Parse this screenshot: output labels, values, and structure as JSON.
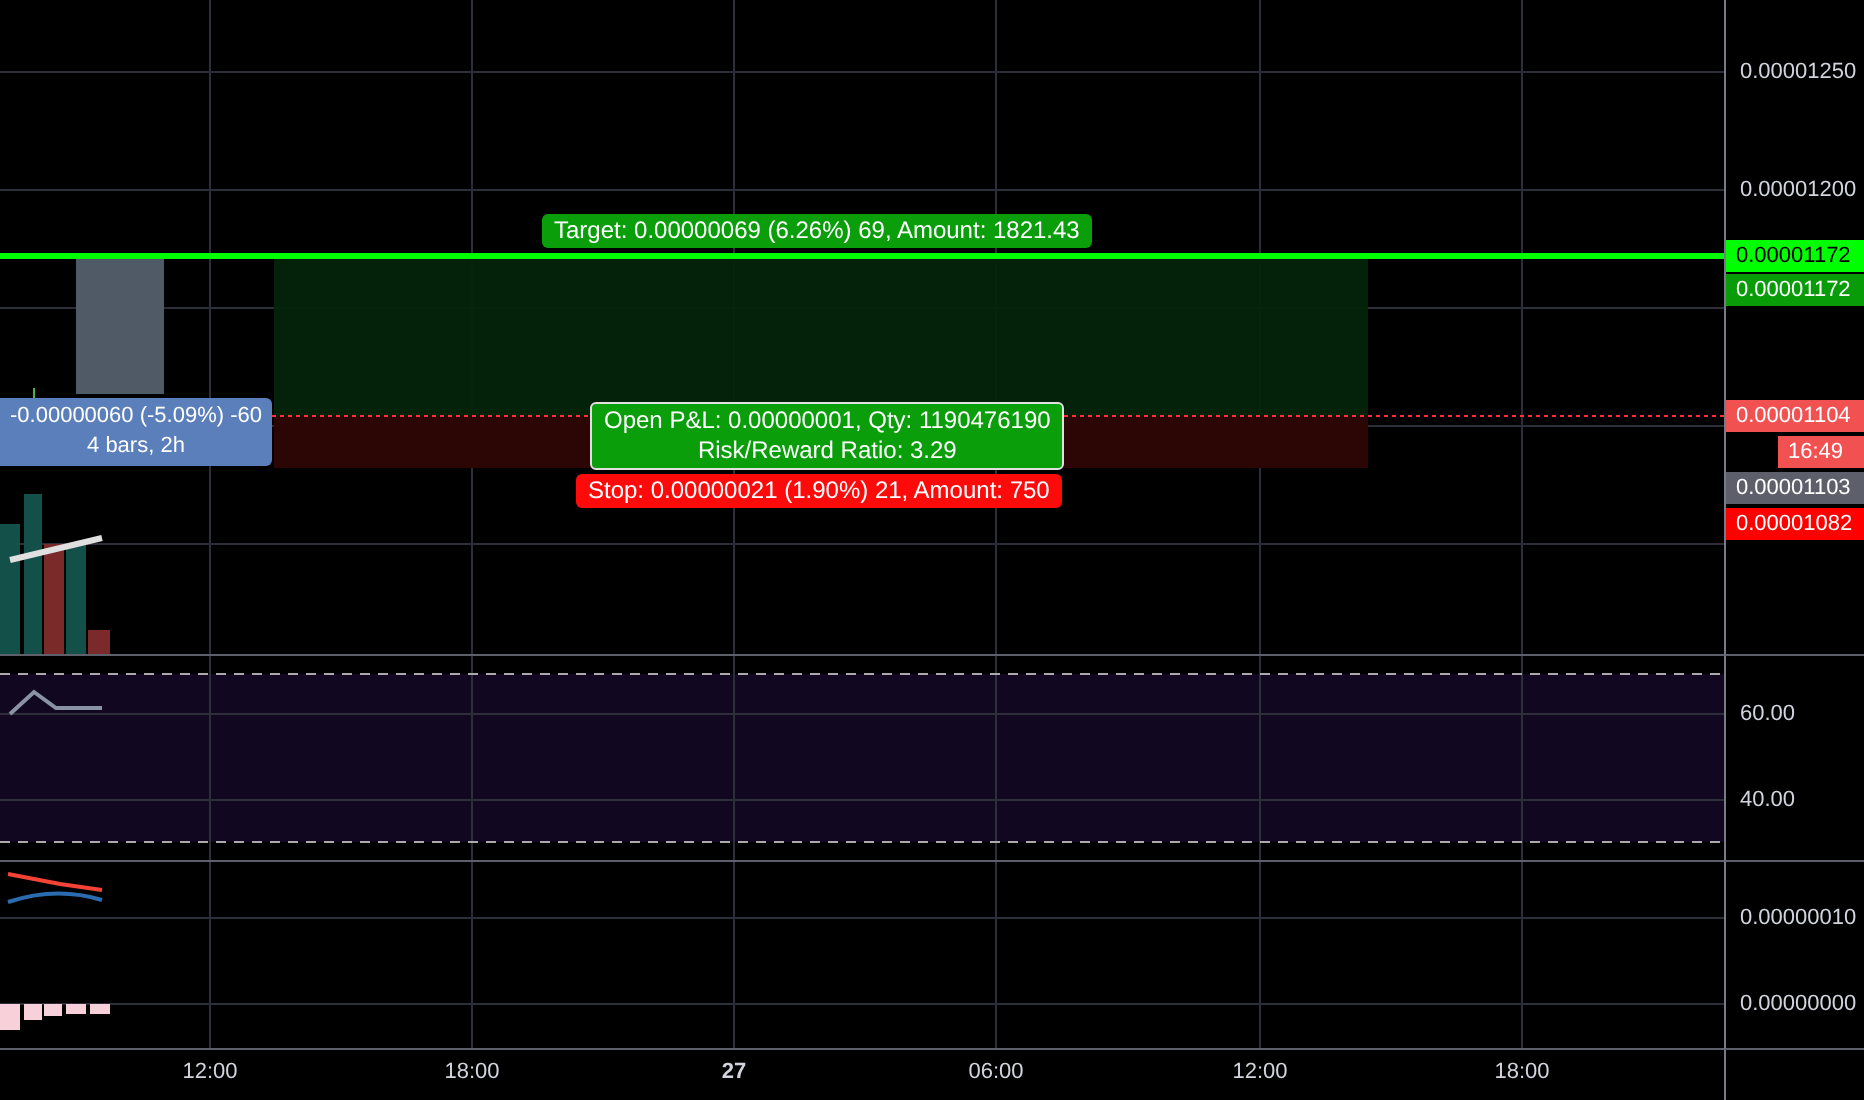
{
  "main_pane": {
    "position": {
      "target_label": "Target: 0.00000069 (6.26%) 69, Amount: 1821.43",
      "pnl_label": "Open P&L: 0.00000001, Qty: 1190476190",
      "ratio_label": "Risk/Reward Ratio: 3.29",
      "stop_label": "Stop: 0.00000021 (1.90%) 21, Amount: 750"
    },
    "measure": {
      "line_1": "-0.00000060 (-5.09%) -60",
      "line_2": "4 bars, 2h"
    },
    "price_axis": [
      "0.00001250",
      "0.00001200"
    ],
    "badges": [
      {
        "text": "0.00001172",
        "color": "#00ff00"
      },
      {
        "text": "0.00001172",
        "color": "#089c08"
      },
      {
        "text": "0.00001104",
        "color": "#f25151"
      },
      {
        "text": "16:49",
        "color": "#f25151"
      },
      {
        "text": "0.00001103",
        "color": "#5d606b"
      },
      {
        "text": "0.00001082",
        "color": "#ff0000"
      }
    ]
  },
  "rsi_pane": {
    "axis": [
      "60.00",
      "40.00"
    ]
  },
  "macd_pane": {
    "axis": [
      "0.00000010",
      "0.00000000"
    ]
  },
  "time_axis": [
    "12:00",
    "18:00",
    "27",
    "06:00",
    "12:00",
    "18:00"
  ]
}
